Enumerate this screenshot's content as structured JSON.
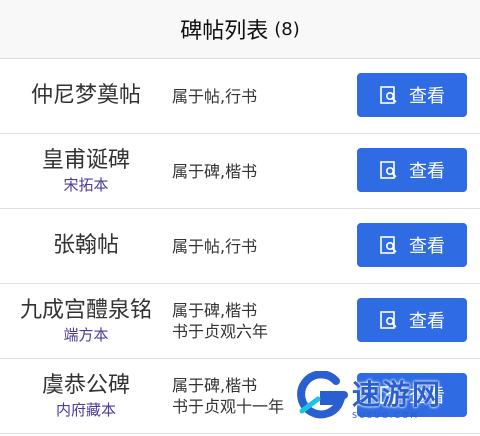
{
  "header": {
    "title": "碑帖列表",
    "count": "(8)"
  },
  "items": [
    {
      "name": "仲尼梦奠帖",
      "sub": "",
      "line1": "属于帖,行书",
      "line2": "",
      "button": "查看"
    },
    {
      "name": "皇甫诞碑",
      "sub": "宋拓本",
      "line1": "属于碑,楷书",
      "line2": "",
      "button": "查看"
    },
    {
      "name": "张翰帖",
      "sub": "",
      "line1": "属于帖,行书",
      "line2": "",
      "button": "查看"
    },
    {
      "name": "九成宫醴泉铭",
      "sub": "端方本",
      "line1": "属于碑,楷书",
      "line2": "书于贞观六年",
      "button": "查看"
    },
    {
      "name": "虞恭公碑",
      "sub": "内府藏本",
      "line1": "属于碑,楷书",
      "line2": "书于贞观十一年",
      "button": "查看"
    }
  ],
  "watermark": {
    "text": "速游网",
    "small": "SUSUO.COM"
  },
  "colors": {
    "button": "#2f6be3",
    "subtitle": "#4b3b9a"
  },
  "icons": {
    "view": "search-document-icon",
    "logo": "g-logo-icon"
  }
}
